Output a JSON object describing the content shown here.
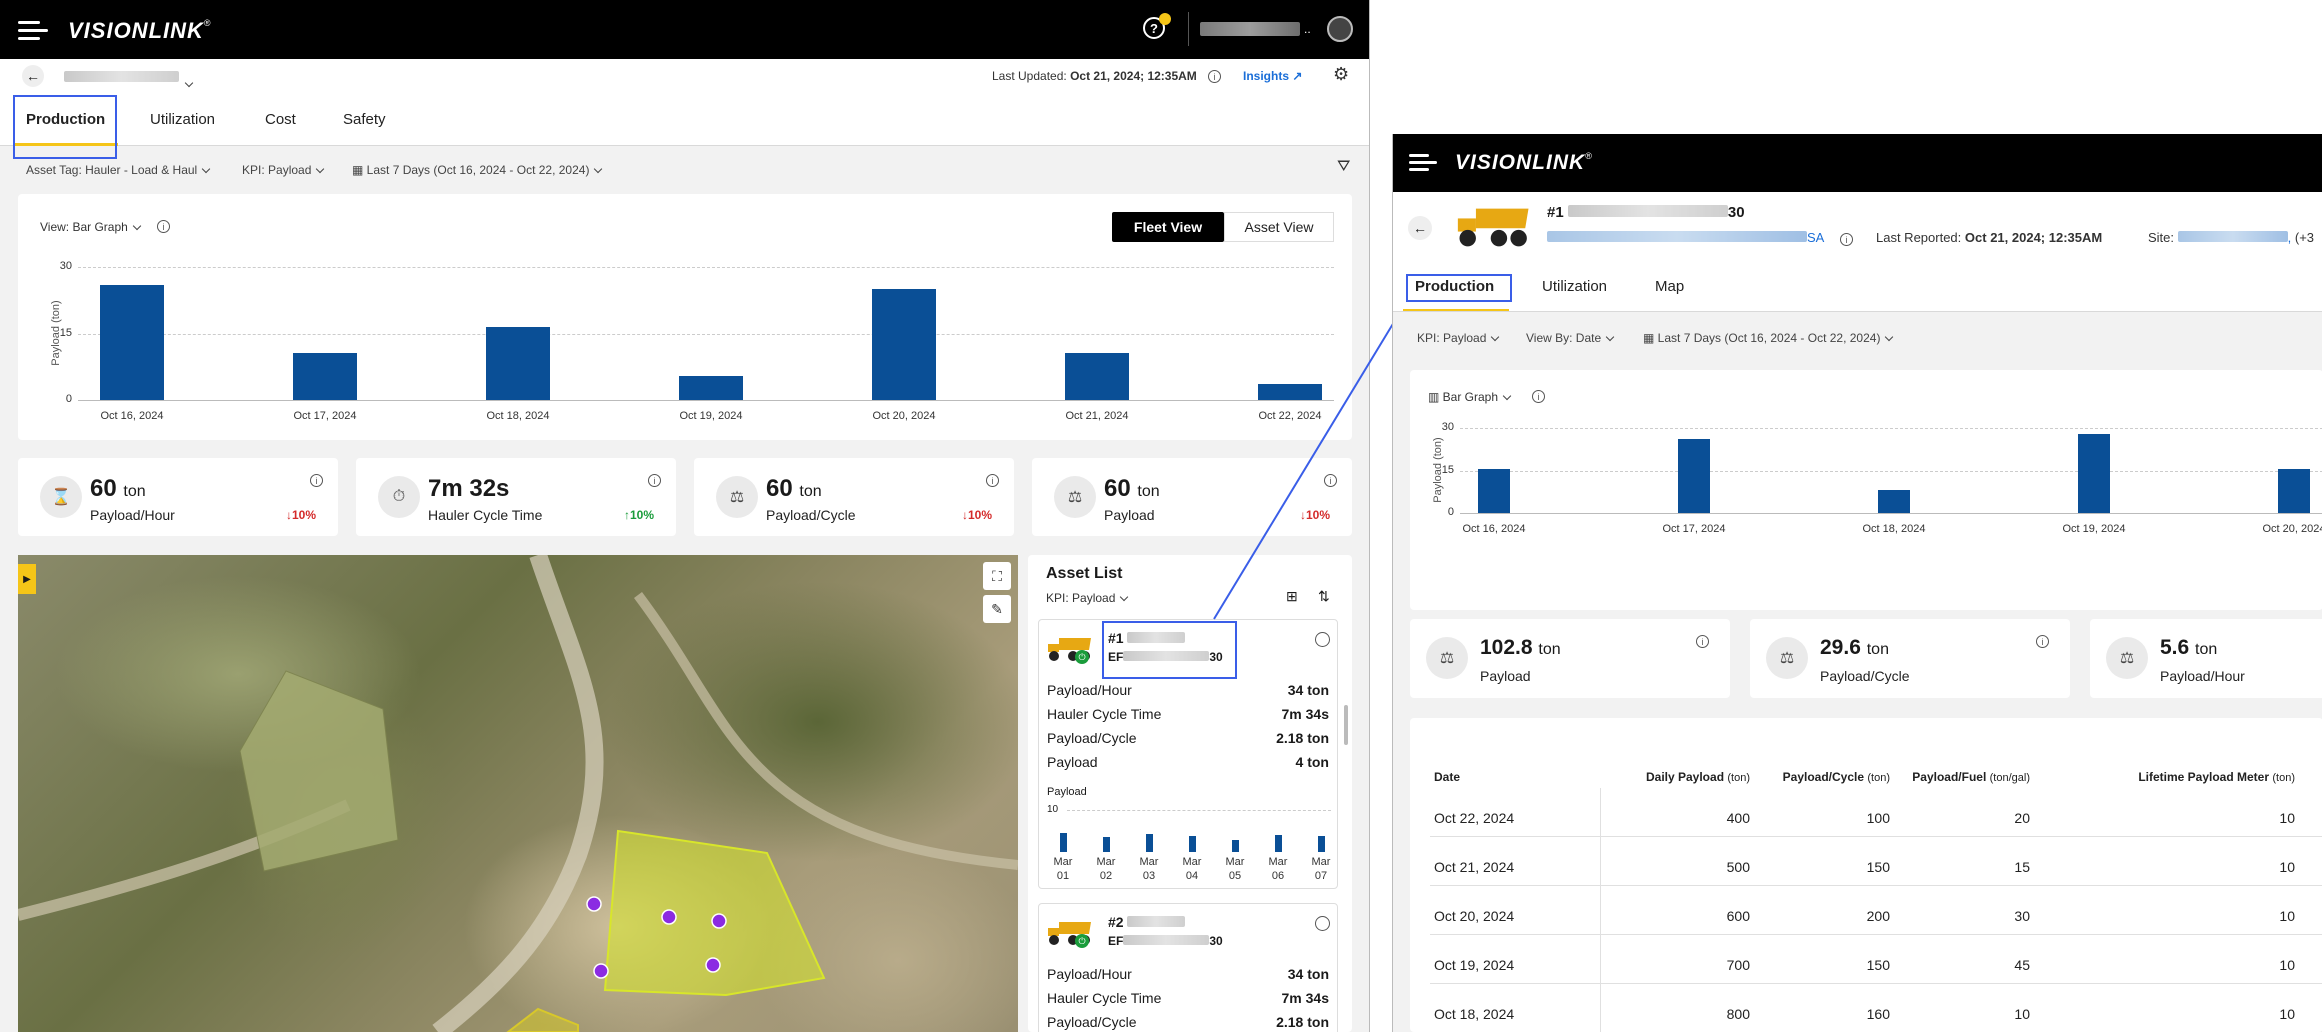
{
  "left": {
    "header": {
      "logo": "VISIONLINK",
      "user_name_blurred": ""
    },
    "subheader": {
      "last_updated_label": "Last Updated:",
      "last_updated_value": "Oct 21, 2024; 12:35AM",
      "insights": "Insights"
    },
    "tabs": [
      "Production",
      "Utilization",
      "Cost",
      "Safety"
    ],
    "filters": {
      "asset_tag": "Asset Tag: Hauler - Load & Haul",
      "kpi": "KPI: Payload",
      "date_range": "Last 7 Days (Oct 16, 2024 - Oct 22, 2024)"
    },
    "chart_controls": {
      "view": "View: Bar Graph",
      "fleet_view": "Fleet View",
      "asset_view": "Asset View"
    },
    "kpis": [
      {
        "value": "60",
        "unit": "ton",
        "label": "Payload/Hour",
        "trend": "↓10%",
        "dir": "down"
      },
      {
        "value": "7m 32s",
        "unit": "",
        "label": "Hauler Cycle Time",
        "trend": "↑10%",
        "dir": "up"
      },
      {
        "value": "60",
        "unit": "ton",
        "label": "Payload/Cycle",
        "trend": "↓10%",
        "dir": "down"
      },
      {
        "value": "60",
        "unit": "ton",
        "label": "Payload",
        "trend": "↓10%",
        "dir": "down"
      }
    ],
    "asset_list": {
      "title": "Asset List",
      "kpi": "KPI: Payload",
      "assets": [
        {
          "name": "#1",
          "serial_suffix": "30",
          "serial_prefix": "EF",
          "rows": [
            {
              "label": "Payload/Hour",
              "value": "34 ton"
            },
            {
              "label": "Hauler Cycle Time",
              "value": "7m 34s"
            },
            {
              "label": "Payload/Cycle",
              "value": "2.18 ton"
            },
            {
              "label": "Payload",
              "value": "4 ton"
            }
          ],
          "mini_chart_title": "Payload",
          "mini_chart_max": "10",
          "mini_bars": [
            {
              "month": "Mar",
              "day": "01",
              "value": 4.5
            },
            {
              "month": "Mar",
              "day": "02",
              "value": 3.5
            },
            {
              "month": "Mar",
              "day": "03",
              "value": 4.2
            },
            {
              "month": "Mar",
              "day": "04",
              "value": 3.8
            },
            {
              "month": "Mar",
              "day": "05",
              "value": 2.8
            },
            {
              "month": "Mar",
              "day": "06",
              "value": 4.0
            },
            {
              "month": "Mar",
              "day": "07",
              "value": 3.9
            }
          ]
        },
        {
          "name": "#2",
          "serial_suffix": "30",
          "serial_prefix": "EF",
          "rows": [
            {
              "label": "Payload/Hour",
              "value": "34 ton"
            },
            {
              "label": "Hauler Cycle Time",
              "value": "7m 34s"
            },
            {
              "label": "Payload/Cycle",
              "value": "2.18 ton"
            }
          ]
        }
      ]
    }
  },
  "right": {
    "header": {
      "logo": "VISIONLINK"
    },
    "asset": {
      "name": "#1",
      "name_suffix": "30",
      "location_suffix": "SA",
      "last_reported_label": "Last Reported:",
      "last_reported_value": "Oct 21, 2024; 12:35AM",
      "site_label": "Site:",
      "site_more": "(+3"
    },
    "tabs": [
      "Production",
      "Utilization",
      "Map"
    ],
    "filters": {
      "kpi": "KPI: Payload",
      "view_by": "View By: Date",
      "date_range": "Last 7 Days (Oct 16, 2024 - Oct 22, 2024)"
    },
    "chart_view": "Bar Graph",
    "kpis": [
      {
        "value": "102.8",
        "unit": "ton",
        "label": "Payload"
      },
      {
        "value": "29.6",
        "unit": "ton",
        "label": "Payload/Cycle"
      },
      {
        "value": "5.6",
        "unit": "ton",
        "label": "Payload/Hour"
      }
    ],
    "table": {
      "headers": [
        {
          "label": "Date",
          "unit": ""
        },
        {
          "label": "Daily Payload",
          "unit": "(ton)"
        },
        {
          "label": "Payload/Cycle",
          "unit": "(ton)"
        },
        {
          "label": "Payload/Fuel",
          "unit": "(ton/gal)"
        },
        {
          "label": "Lifetime Payload Meter",
          "unit": "(ton)"
        }
      ],
      "rows": [
        [
          "Oct 22, 2024",
          "400",
          "100",
          "20",
          "10"
        ],
        [
          "Oct 21, 2024",
          "500",
          "150",
          "15",
          "10"
        ],
        [
          "Oct 20, 2024",
          "600",
          "200",
          "30",
          "10"
        ],
        [
          "Oct 19, 2024",
          "700",
          "150",
          "45",
          "10"
        ],
        [
          "Oct 18, 2024",
          "800",
          "160",
          "10",
          "10"
        ]
      ]
    }
  },
  "chart_data": [
    {
      "type": "bar",
      "ylabel": "Payload (ton)",
      "ylim": [
        0,
        30
      ],
      "yticks": [
        0,
        15,
        30
      ],
      "categories": [
        "Oct 16, 2024",
        "Oct 17, 2024",
        "Oct 18, 2024",
        "Oct 19, 2024",
        "Oct 20, 2024",
        "Oct 21, 2024",
        "Oct 22, 2024"
      ],
      "values": [
        26,
        10.5,
        16.5,
        5.5,
        25,
        10.5,
        3.5
      ],
      "color": "#0a4f96"
    },
    {
      "type": "bar",
      "ylabel": "Payload (ton)",
      "ylim": [
        0,
        30
      ],
      "yticks": [
        0,
        15,
        30
      ],
      "categories": [
        "Oct 16, 2024",
        "Oct 17, 2024",
        "Oct 18, 2024",
        "Oct 19, 2024",
        "Oct 20, 2024"
      ],
      "values": [
        15.5,
        26,
        8,
        28,
        15.5
      ],
      "color": "#0a4f96"
    }
  ]
}
